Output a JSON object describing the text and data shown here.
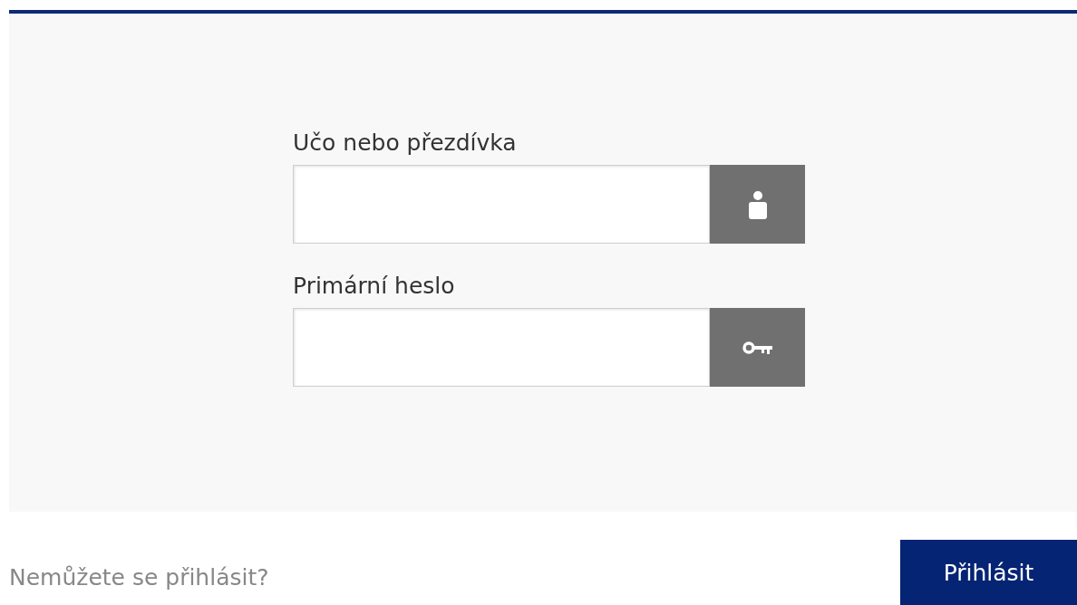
{
  "fields": [
    {
      "kind": "user",
      "label": "Učo nebo přezdívka"
    },
    {
      "kind": "password",
      "label": "Primární heslo"
    }
  ],
  "help_link": "Nemůžete se přihlásit?",
  "submit": "Přihlásit"
}
